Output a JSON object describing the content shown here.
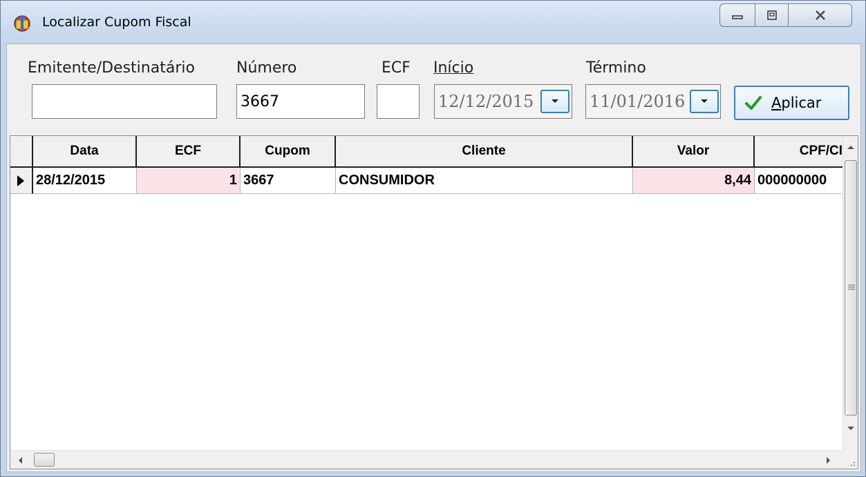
{
  "window": {
    "title": "Localizar Cupom Fiscal",
    "icon": "app-gift-icon",
    "controls": {
      "minimize": "minimize-icon",
      "maximize": "maximize-icon",
      "close": "close-icon"
    }
  },
  "filters": {
    "emitente_label": "Emitente/Destinatário",
    "emitente_value": "",
    "numero_label": "Número",
    "numero_value": "3667",
    "ecf_label": "ECF",
    "ecf_value": "",
    "inicio_label": "Início",
    "inicio_value": "12/12/2015",
    "termino_label": "Término",
    "termino_value": "11/01/2016",
    "apply_label": "Aplicar"
  },
  "grid": {
    "columns": [
      "Data",
      "ECF",
      "Cupom",
      "Cliente",
      "Valor",
      "CPF/CI"
    ],
    "rows": [
      [
        "28/12/2015",
        "1",
        "3667",
        "CONSUMIDOR",
        "8,44",
        "000000000"
      ]
    ]
  },
  "colors": {
    "selected_cell": "#f9e3e6",
    "titlebar": "#c3d5ec",
    "accent_border": "#3c7fb1",
    "check_green": "#1f9a1f"
  }
}
